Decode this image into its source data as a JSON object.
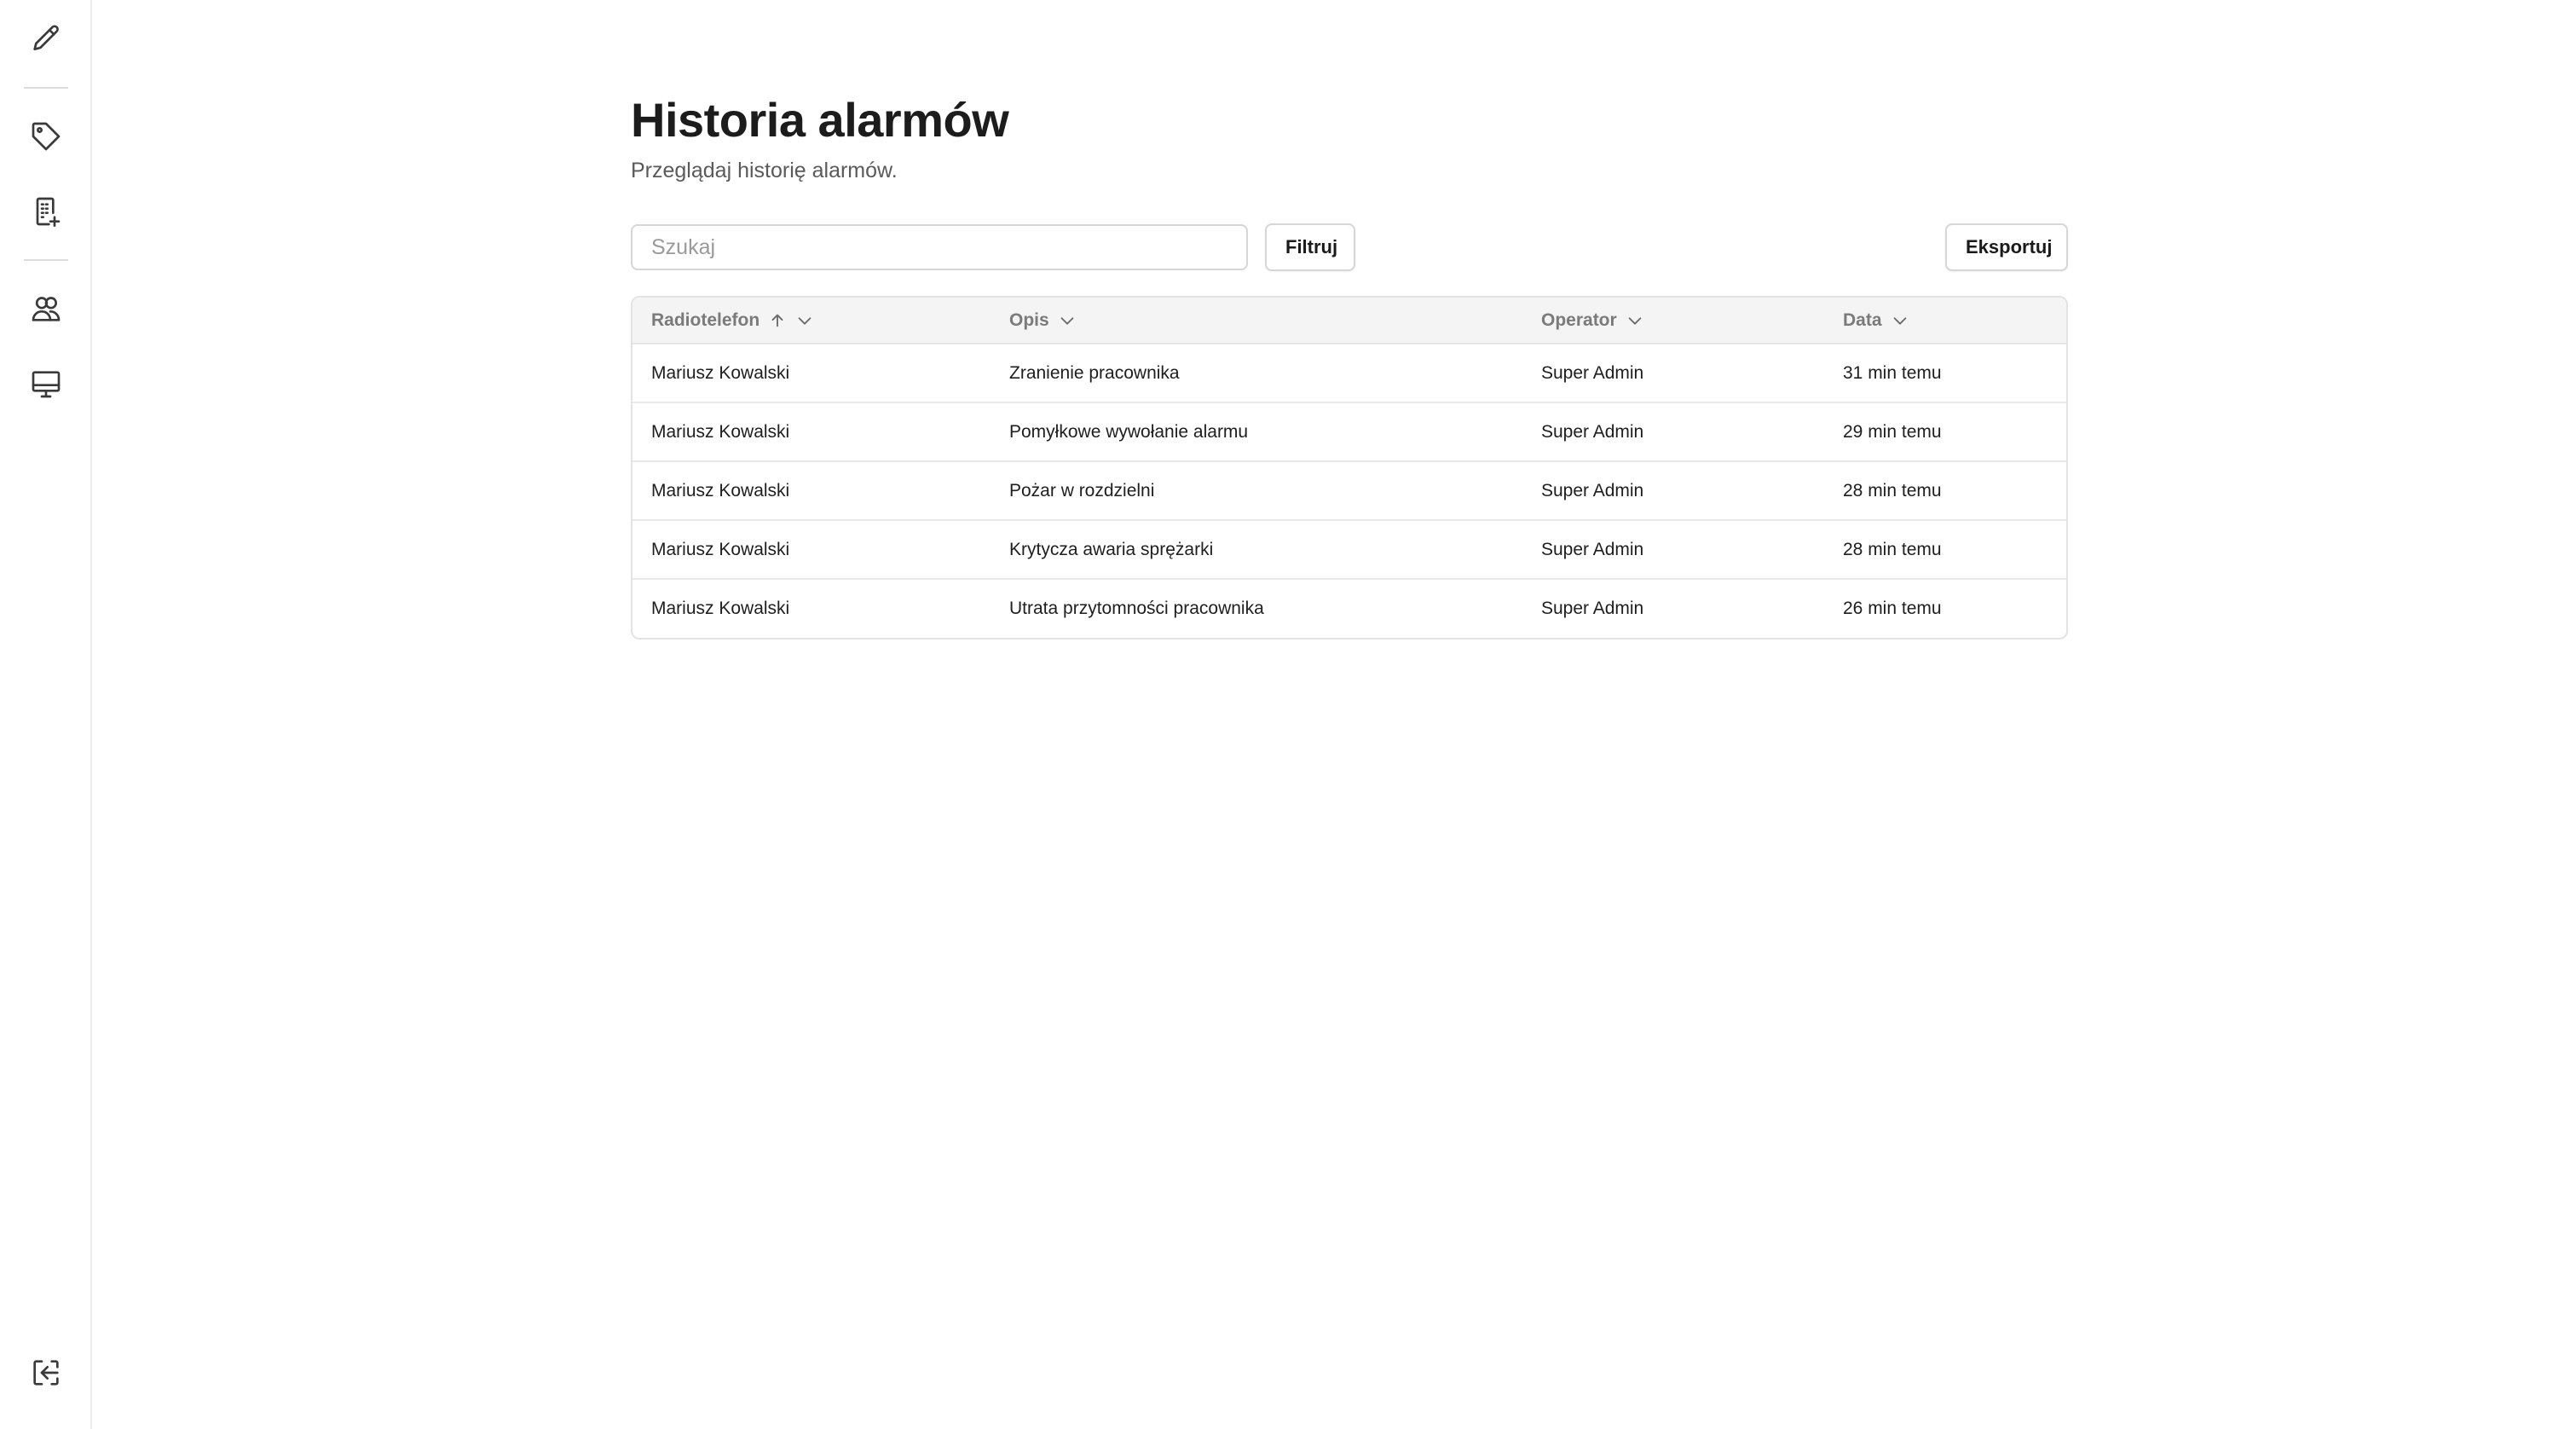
{
  "sidebar": {
    "items": [
      {
        "icon": "pencil-icon"
      },
      {
        "icon": "tag-icon"
      },
      {
        "icon": "device-add-icon"
      },
      {
        "icon": "users-icon"
      },
      {
        "icon": "monitor-icon"
      },
      {
        "icon": "logout-icon"
      }
    ]
  },
  "header": {
    "title": "Historia alarmów",
    "subtitle": "Przeglądaj historię alarmów."
  },
  "toolbar": {
    "search_placeholder": "Szukaj",
    "search_value": "",
    "filter_label": "Filtruj",
    "export_label": "Eksportuj"
  },
  "table": {
    "columns": [
      {
        "label": "Radiotelefon",
        "sorted": "asc"
      },
      {
        "label": "Opis"
      },
      {
        "label": "Operator"
      },
      {
        "label": "Data"
      }
    ],
    "rows": [
      [
        "Mariusz Kowalski",
        "Zranienie pracownika",
        "Super Admin",
        "31 min temu"
      ],
      [
        "Mariusz Kowalski",
        "Pomyłkowe wywołanie alarmu",
        "Super Admin",
        "29 min temu"
      ],
      [
        "Mariusz Kowalski",
        "Pożar w rozdzielni",
        "Super Admin",
        "28 min temu"
      ],
      [
        "Mariusz Kowalski",
        "Krytycza awaria sprężarki",
        "Super Admin",
        "28 min temu"
      ],
      [
        "Mariusz Kowalski",
        "Utrata przytomności pracownika",
        "Super Admin",
        "26 min temu"
      ]
    ]
  },
  "colors": {
    "header_bg": "#f4f4f5",
    "border": "#e3e3e3",
    "text": "#1a1a1a",
    "muted": "#7a7a7a"
  }
}
